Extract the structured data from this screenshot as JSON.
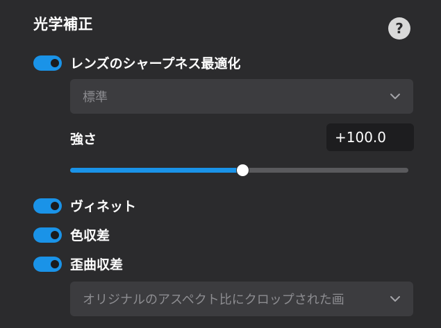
{
  "section": {
    "title": "光学補正",
    "help_label": "?"
  },
  "lens_sharpness": {
    "label": "レンズのシャープネス最適化",
    "enabled": true,
    "mode_value": "標準",
    "strength_label": "強さ",
    "strength_value": "+100.0",
    "slider_level": 0.51
  },
  "vignette": {
    "label": "ヴィネット",
    "enabled": true
  },
  "chromatic_aberration": {
    "label": "色収差",
    "enabled": true
  },
  "distortion": {
    "label": "歪曲収差",
    "enabled": true,
    "mode_value": "オリジナルのアスペクト比にクロップされた画"
  },
  "colors": {
    "accent": "#1a93e8",
    "background": "#2b2b2d",
    "dropdown_bg": "#3c3c3f",
    "value_box_bg": "#1d1d1f"
  }
}
